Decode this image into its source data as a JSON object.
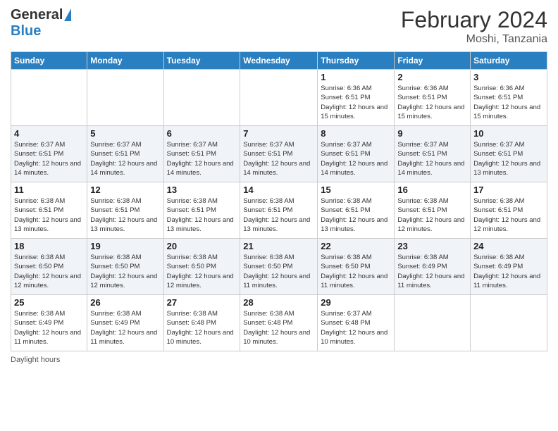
{
  "logo": {
    "general": "General",
    "blue": "Blue"
  },
  "title": "February 2024",
  "location": "Moshi, Tanzania",
  "days_of_week": [
    "Sunday",
    "Monday",
    "Tuesday",
    "Wednesday",
    "Thursday",
    "Friday",
    "Saturday"
  ],
  "footer": "Daylight hours",
  "weeks": [
    [
      {
        "day": "",
        "info": ""
      },
      {
        "day": "",
        "info": ""
      },
      {
        "day": "",
        "info": ""
      },
      {
        "day": "",
        "info": ""
      },
      {
        "day": "1",
        "info": "Sunrise: 6:36 AM\nSunset: 6:51 PM\nDaylight: 12 hours\nand 15 minutes."
      },
      {
        "day": "2",
        "info": "Sunrise: 6:36 AM\nSunset: 6:51 PM\nDaylight: 12 hours\nand 15 minutes."
      },
      {
        "day": "3",
        "info": "Sunrise: 6:36 AM\nSunset: 6:51 PM\nDaylight: 12 hours\nand 15 minutes."
      }
    ],
    [
      {
        "day": "4",
        "info": "Sunrise: 6:37 AM\nSunset: 6:51 PM\nDaylight: 12 hours\nand 14 minutes."
      },
      {
        "day": "5",
        "info": "Sunrise: 6:37 AM\nSunset: 6:51 PM\nDaylight: 12 hours\nand 14 minutes."
      },
      {
        "day": "6",
        "info": "Sunrise: 6:37 AM\nSunset: 6:51 PM\nDaylight: 12 hours\nand 14 minutes."
      },
      {
        "day": "7",
        "info": "Sunrise: 6:37 AM\nSunset: 6:51 PM\nDaylight: 12 hours\nand 14 minutes."
      },
      {
        "day": "8",
        "info": "Sunrise: 6:37 AM\nSunset: 6:51 PM\nDaylight: 12 hours\nand 14 minutes."
      },
      {
        "day": "9",
        "info": "Sunrise: 6:37 AM\nSunset: 6:51 PM\nDaylight: 12 hours\nand 14 minutes."
      },
      {
        "day": "10",
        "info": "Sunrise: 6:37 AM\nSunset: 6:51 PM\nDaylight: 12 hours\nand 13 minutes."
      }
    ],
    [
      {
        "day": "11",
        "info": "Sunrise: 6:38 AM\nSunset: 6:51 PM\nDaylight: 12 hours\nand 13 minutes."
      },
      {
        "day": "12",
        "info": "Sunrise: 6:38 AM\nSunset: 6:51 PM\nDaylight: 12 hours\nand 13 minutes."
      },
      {
        "day": "13",
        "info": "Sunrise: 6:38 AM\nSunset: 6:51 PM\nDaylight: 12 hours\nand 13 minutes."
      },
      {
        "day": "14",
        "info": "Sunrise: 6:38 AM\nSunset: 6:51 PM\nDaylight: 12 hours\nand 13 minutes."
      },
      {
        "day": "15",
        "info": "Sunrise: 6:38 AM\nSunset: 6:51 PM\nDaylight: 12 hours\nand 13 minutes."
      },
      {
        "day": "16",
        "info": "Sunrise: 6:38 AM\nSunset: 6:51 PM\nDaylight: 12 hours\nand 12 minutes."
      },
      {
        "day": "17",
        "info": "Sunrise: 6:38 AM\nSunset: 6:51 PM\nDaylight: 12 hours\nand 12 minutes."
      }
    ],
    [
      {
        "day": "18",
        "info": "Sunrise: 6:38 AM\nSunset: 6:50 PM\nDaylight: 12 hours\nand 12 minutes."
      },
      {
        "day": "19",
        "info": "Sunrise: 6:38 AM\nSunset: 6:50 PM\nDaylight: 12 hours\nand 12 minutes."
      },
      {
        "day": "20",
        "info": "Sunrise: 6:38 AM\nSunset: 6:50 PM\nDaylight: 12 hours\nand 12 minutes."
      },
      {
        "day": "21",
        "info": "Sunrise: 6:38 AM\nSunset: 6:50 PM\nDaylight: 12 hours\nand 11 minutes."
      },
      {
        "day": "22",
        "info": "Sunrise: 6:38 AM\nSunset: 6:50 PM\nDaylight: 12 hours\nand 11 minutes."
      },
      {
        "day": "23",
        "info": "Sunrise: 6:38 AM\nSunset: 6:49 PM\nDaylight: 12 hours\nand 11 minutes."
      },
      {
        "day": "24",
        "info": "Sunrise: 6:38 AM\nSunset: 6:49 PM\nDaylight: 12 hours\nand 11 minutes."
      }
    ],
    [
      {
        "day": "25",
        "info": "Sunrise: 6:38 AM\nSunset: 6:49 PM\nDaylight: 12 hours\nand 11 minutes."
      },
      {
        "day": "26",
        "info": "Sunrise: 6:38 AM\nSunset: 6:49 PM\nDaylight: 12 hours\nand 11 minutes."
      },
      {
        "day": "27",
        "info": "Sunrise: 6:38 AM\nSunset: 6:48 PM\nDaylight: 12 hours\nand 10 minutes."
      },
      {
        "day": "28",
        "info": "Sunrise: 6:38 AM\nSunset: 6:48 PM\nDaylight: 12 hours\nand 10 minutes."
      },
      {
        "day": "29",
        "info": "Sunrise: 6:37 AM\nSunset: 6:48 PM\nDaylight: 12 hours\nand 10 minutes."
      },
      {
        "day": "",
        "info": ""
      },
      {
        "day": "",
        "info": ""
      }
    ]
  ]
}
